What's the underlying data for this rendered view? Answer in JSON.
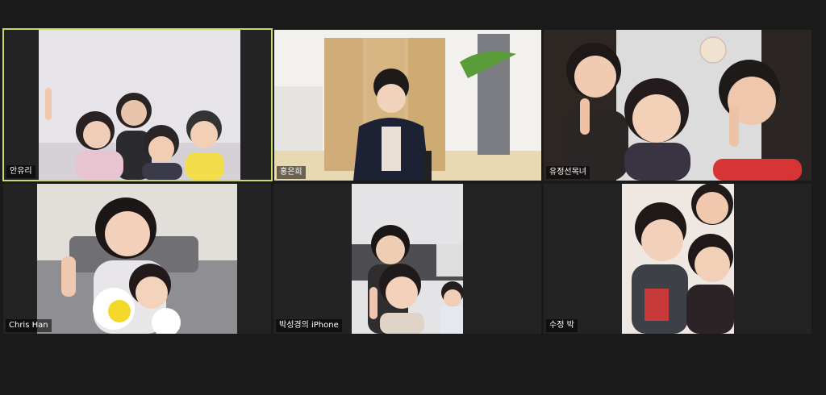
{
  "meeting": {
    "participants": [
      {
        "name": "안유리",
        "active": true
      },
      {
        "name": "홍은희",
        "active": false
      },
      {
        "name": "유정선목녀",
        "active": false
      },
      {
        "name": "Chris Han",
        "active": false
      },
      {
        "name": "박성경의 iPhone",
        "active": false
      },
      {
        "name": "수정 박",
        "active": false
      }
    ]
  },
  "colors": {
    "background": "#1a1a1a",
    "tile": "#232323",
    "active_border": "#c9d86b"
  }
}
